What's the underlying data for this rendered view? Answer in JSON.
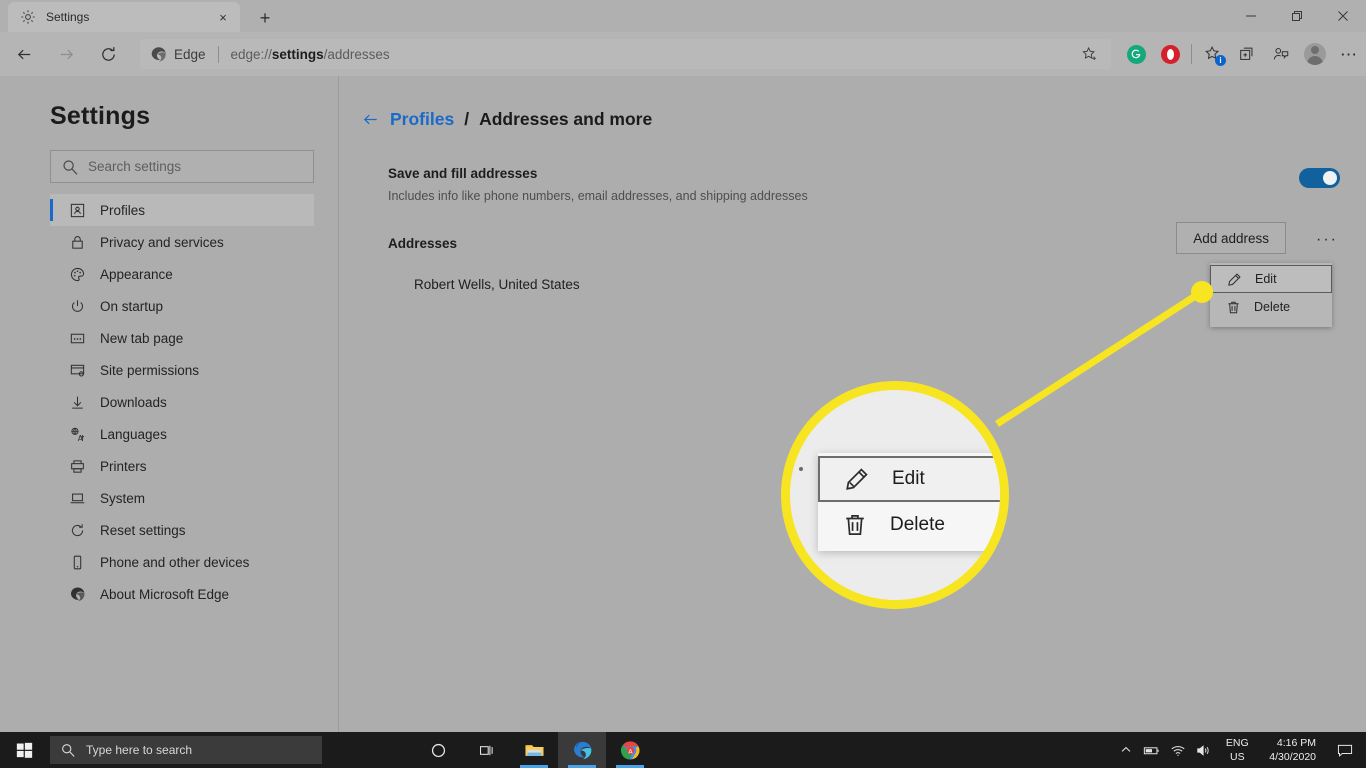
{
  "window": {
    "tab": {
      "title": "Settings",
      "favicon": "gear-icon",
      "close": "×"
    },
    "new_tab": "+",
    "controls": {
      "minimize": "minimize-icon",
      "maximize": "restore-icon",
      "close": "close-icon"
    }
  },
  "toolbar": {
    "back": "back-arrow-icon",
    "forward": "forward-arrow-icon",
    "refresh": "refresh-icon",
    "brand": "Edge",
    "url_prefix": "edge://",
    "url_bold": "settings",
    "url_suffix": "/addresses",
    "full_url": "edge://settings/addresses",
    "favorite": "star-plus-icon",
    "extensions": [
      {
        "name": "grammarly-extension-icon",
        "color": "#15a87b",
        "glyph": "G"
      },
      {
        "name": "opera-extension-icon",
        "color": "#d5212b",
        "glyph": "O"
      }
    ],
    "favorites": "favorites-star-icon",
    "favorites_badge": "i",
    "collections": "collections-icon",
    "share": "share-profile-icon",
    "profile": "avatar",
    "settings_menu": "⋯"
  },
  "sidebar": {
    "title": "Settings",
    "search": {
      "placeholder": "Search settings",
      "value": "",
      "icon": "search-icon"
    },
    "items": [
      {
        "label": "Profiles",
        "icon": "profile-card-icon",
        "active": true
      },
      {
        "label": "Privacy and services",
        "icon": "lock-icon",
        "active": false
      },
      {
        "label": "Appearance",
        "icon": "palette-icon",
        "active": false
      },
      {
        "label": "On startup",
        "icon": "power-icon",
        "active": false
      },
      {
        "label": "New tab page",
        "icon": "new-tab-page-icon",
        "active": false
      },
      {
        "label": "Site permissions",
        "icon": "site-permissions-icon",
        "active": false
      },
      {
        "label": "Downloads",
        "icon": "download-arrow-icon",
        "active": false
      },
      {
        "label": "Languages",
        "icon": "languages-icon",
        "active": false
      },
      {
        "label": "Printers",
        "icon": "printer-icon",
        "active": false
      },
      {
        "label": "System",
        "icon": "laptop-icon",
        "active": false
      },
      {
        "label": "Reset settings",
        "icon": "reset-circular-arrow-icon",
        "active": false
      },
      {
        "label": "Phone and other devices",
        "icon": "phone-icon",
        "active": false
      },
      {
        "label": "About Microsoft Edge",
        "icon": "edge-logo-icon",
        "active": false
      }
    ]
  },
  "main": {
    "back_icon": "back-arrow-icon",
    "breadcrumb": {
      "parent": "Profiles",
      "separator": "/",
      "current": "Addresses and more"
    },
    "save_and_fill": {
      "title": "Save and fill addresses",
      "subtitle": "Includes info like phone numbers, email addresses, and shipping addresses",
      "toggle_on": true
    },
    "addresses": {
      "label": "Addresses",
      "add_button": "Add address",
      "more_menu": "···",
      "entries": [
        {
          "name": "Robert Wells, United States",
          "more_menu": "···"
        }
      ]
    },
    "context_menu": {
      "items": [
        {
          "label": "Edit",
          "icon": "pencil-icon",
          "focused": true
        },
        {
          "label": "Delete",
          "icon": "trash-icon",
          "focused": false
        }
      ]
    }
  },
  "callout": {
    "highlight_color": "#f7e522",
    "magnified_menu": {
      "items": [
        {
          "label": "Edit",
          "icon": "pencil-icon",
          "focused": true
        },
        {
          "label": "Delete",
          "icon": "trash-icon",
          "focused": false
        }
      ]
    }
  },
  "taskbar": {
    "start": "windows-start-icon",
    "search": {
      "placeholder": "Type here to search",
      "icon": "search-icon"
    },
    "cortana": "cortana-circle-icon",
    "task_view": "task-view-icon",
    "apps": [
      {
        "name": "file-explorer-icon"
      },
      {
        "name": "microsoft-edge-icon"
      },
      {
        "name": "google-chrome-icon"
      }
    ],
    "tray": {
      "chevron": "show-hidden-icons-chevron",
      "battery": "battery-icon",
      "wifi": "wifi-icon",
      "volume": "volume-icon",
      "language_line1": "ENG",
      "language_line2": "US",
      "time": "4:16 PM",
      "date": "4/30/2020",
      "action_center": "action-center-icon"
    }
  }
}
